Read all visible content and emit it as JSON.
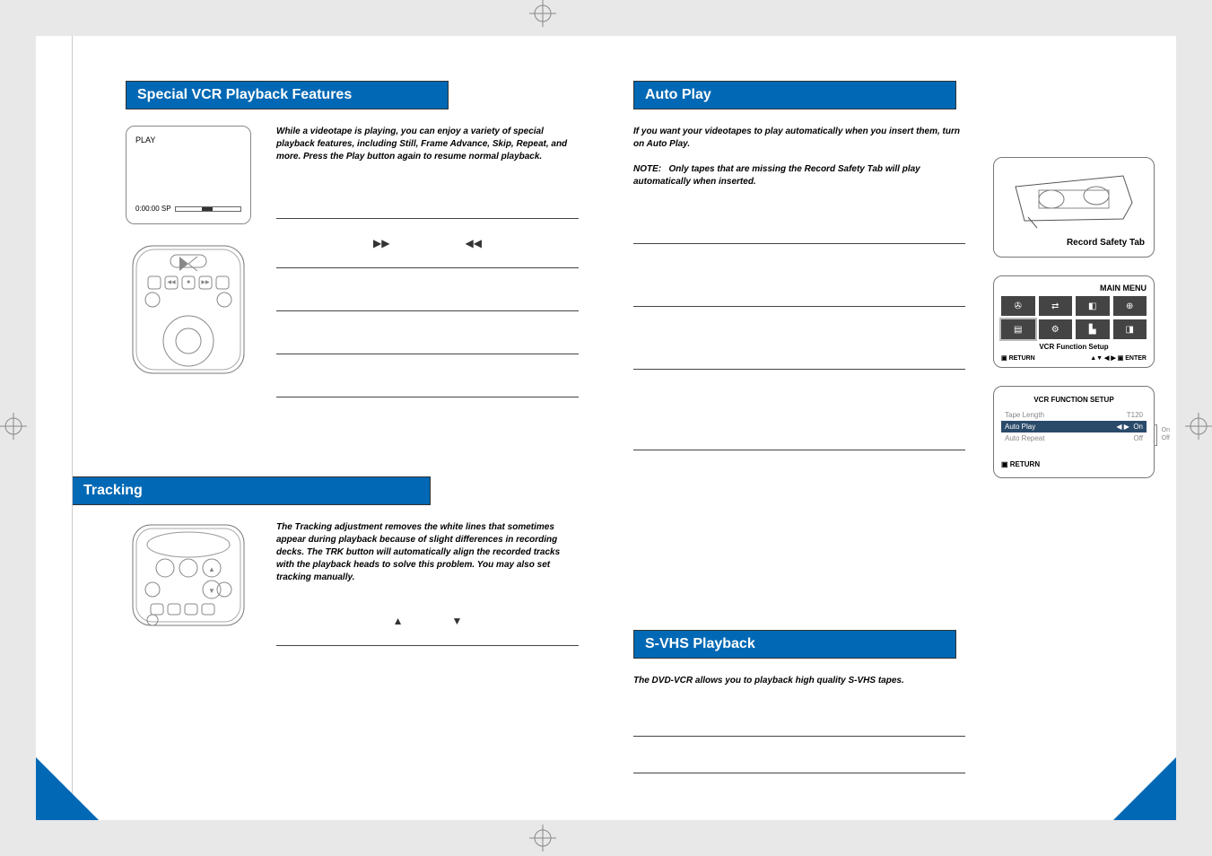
{
  "sections": {
    "special": {
      "title": "Special VCR Playback Features",
      "intro": "While a videotape is playing, you can enjoy a variety of special playback features, including Still, Frame Advance, Skip, Repeat, and more. Press the Play button again to resume normal playback.",
      "glyphs_ff": "❯❯",
      "glyphs_rew": "❮❮"
    },
    "tracking": {
      "title": "Tracking",
      "intro": "The Tracking adjustment removes the white lines that sometimes appear during playback because of slight differences in recording decks. The TRK button will automatically align the recorded tracks with the playback heads to solve this problem. You may also set tracking manually.",
      "glyph_up": "▲",
      "glyph_down": "▼"
    },
    "autoplay": {
      "title": "Auto Play",
      "intro": "If you want your videotapes to play automatically when you insert them, turn on Auto Play.",
      "note_label": "NOTE:",
      "note_body": "Only tapes that are missing the Record Safety Tab will play automatically when inserted."
    },
    "svhs": {
      "title": "S-VHS Playback",
      "intro": "The DVD-VCR allows you to playback high quality S-VHS tapes."
    }
  },
  "osd": {
    "status": "PLAY",
    "time": "0:00:00 SP"
  },
  "cassette_label": "Record Safety Tab",
  "main_menu": {
    "title": "MAIN MENU",
    "subtitle": "VCR Function Setup",
    "return_label": "RETURN",
    "enter_label": "ENTER",
    "arrows": "▲▼ ◀ ▶"
  },
  "setup_menu": {
    "title": "VCR FUNCTION SETUP",
    "rows": [
      {
        "label": "Tape Length",
        "value": "T120",
        "highlight": false
      },
      {
        "label": "Auto Play",
        "value": "On",
        "arrows": "◀ ▶",
        "highlight": true
      },
      {
        "label": "Auto Repeat",
        "value": "Off",
        "highlight": false
      }
    ],
    "side": [
      "On",
      "Off"
    ],
    "return_label": "RETURN"
  },
  "icons": {
    "ff": "▶▶",
    "rew": "◀◀"
  }
}
